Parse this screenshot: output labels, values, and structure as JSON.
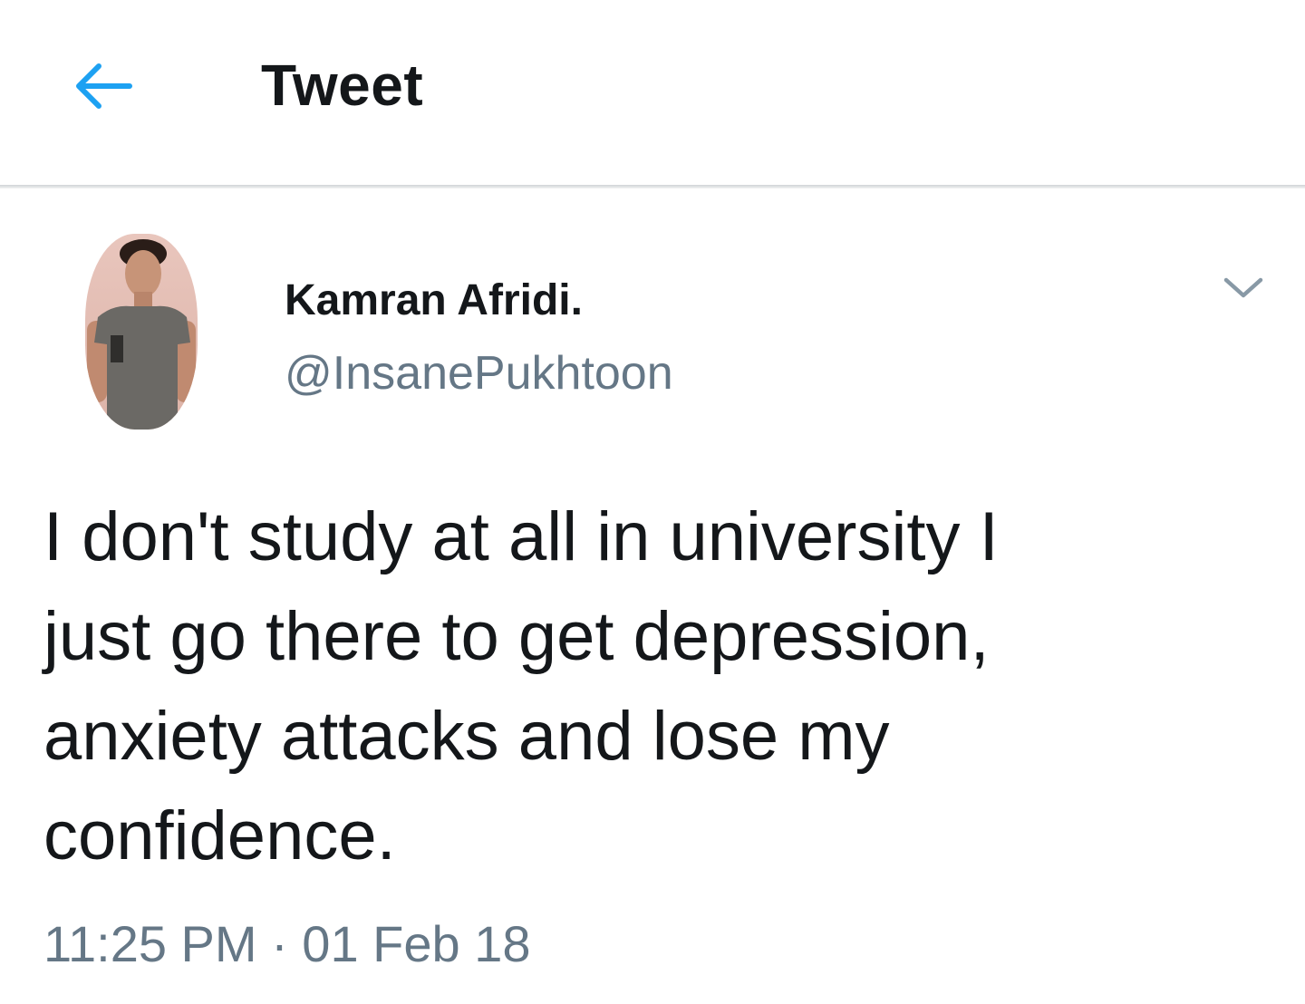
{
  "header": {
    "back_icon": "arrow-left-icon",
    "title": "Tweet",
    "accent_color": "#1DA1F2"
  },
  "tweet": {
    "author": {
      "name": "Kamran Afridi.",
      "handle": "@InsanePukhtoon",
      "avatar": "profile-photo"
    },
    "menu_icon": "chevron-down-icon",
    "text": "I don't study at all in university I\njust go there to get depression,\nanxiety attacks and lose my\nconfidence.",
    "timestamp": "11:25 PM · 01 Feb 18"
  },
  "colors": {
    "text_primary": "#14171A",
    "text_secondary": "#657786",
    "icon_muted": "#8899A6"
  }
}
